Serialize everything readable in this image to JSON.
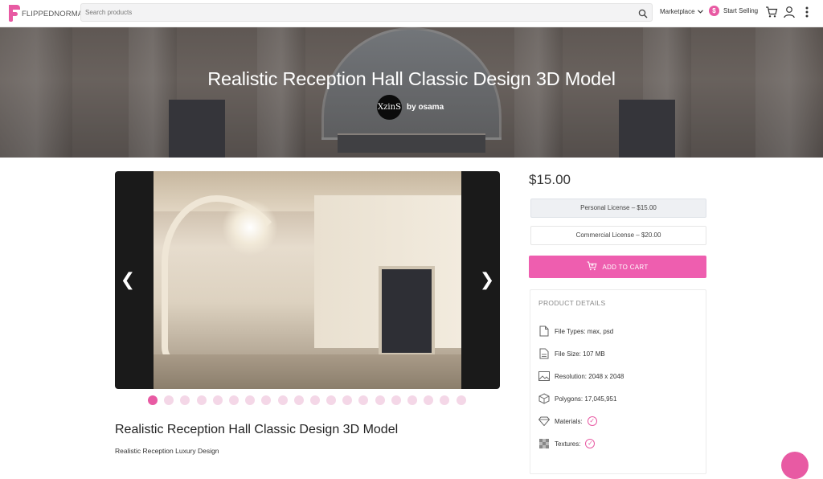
{
  "header": {
    "logo_text": "FLIPPEDNORMALS",
    "search_placeholder": "Search products",
    "marketplace_label": "Marketplace",
    "start_selling_label": "Start Selling",
    "sell_coin_symbol": "$"
  },
  "hero": {
    "title": "Realistic Reception Hall Classic Design 3D Model",
    "author_prefix": "by",
    "author_name": "osama",
    "author_avatar_text": "XzinS"
  },
  "gallery": {
    "prev_symbol": "❮",
    "next_symbol": "❯",
    "slide_count": 20,
    "active_index": 0
  },
  "product": {
    "name": "Realistic Reception Hall Classic Design 3D Model",
    "subtitle": "Realistic Reception Luxury Design"
  },
  "purchase": {
    "price": "$15.00",
    "licenses": [
      {
        "label": "Personal License – $15.00",
        "selected": true
      },
      {
        "label": "Commercial License – $20.00",
        "selected": false
      }
    ],
    "add_to_cart_label": "ADD TO CART"
  },
  "details": {
    "title": "PRODUCT DETAILS",
    "rows": [
      {
        "icon": "file-icon",
        "label": "File Types:",
        "value": "max, psd"
      },
      {
        "icon": "file-size-icon",
        "label": "File Size:",
        "value": "107 MB"
      },
      {
        "icon": "image-icon",
        "label": "Resolution:",
        "value": "2048 x 2048"
      },
      {
        "icon": "polygon-icon",
        "label": "Polygons:",
        "value": "17,045,951"
      },
      {
        "icon": "diamond-icon",
        "label": "Materials:",
        "value": ""
      },
      {
        "icon": "texture-icon",
        "label": "Textures:",
        "value": ""
      }
    ]
  },
  "colors": {
    "accent": "#e85aa3",
    "button": "#ee5eaf"
  }
}
